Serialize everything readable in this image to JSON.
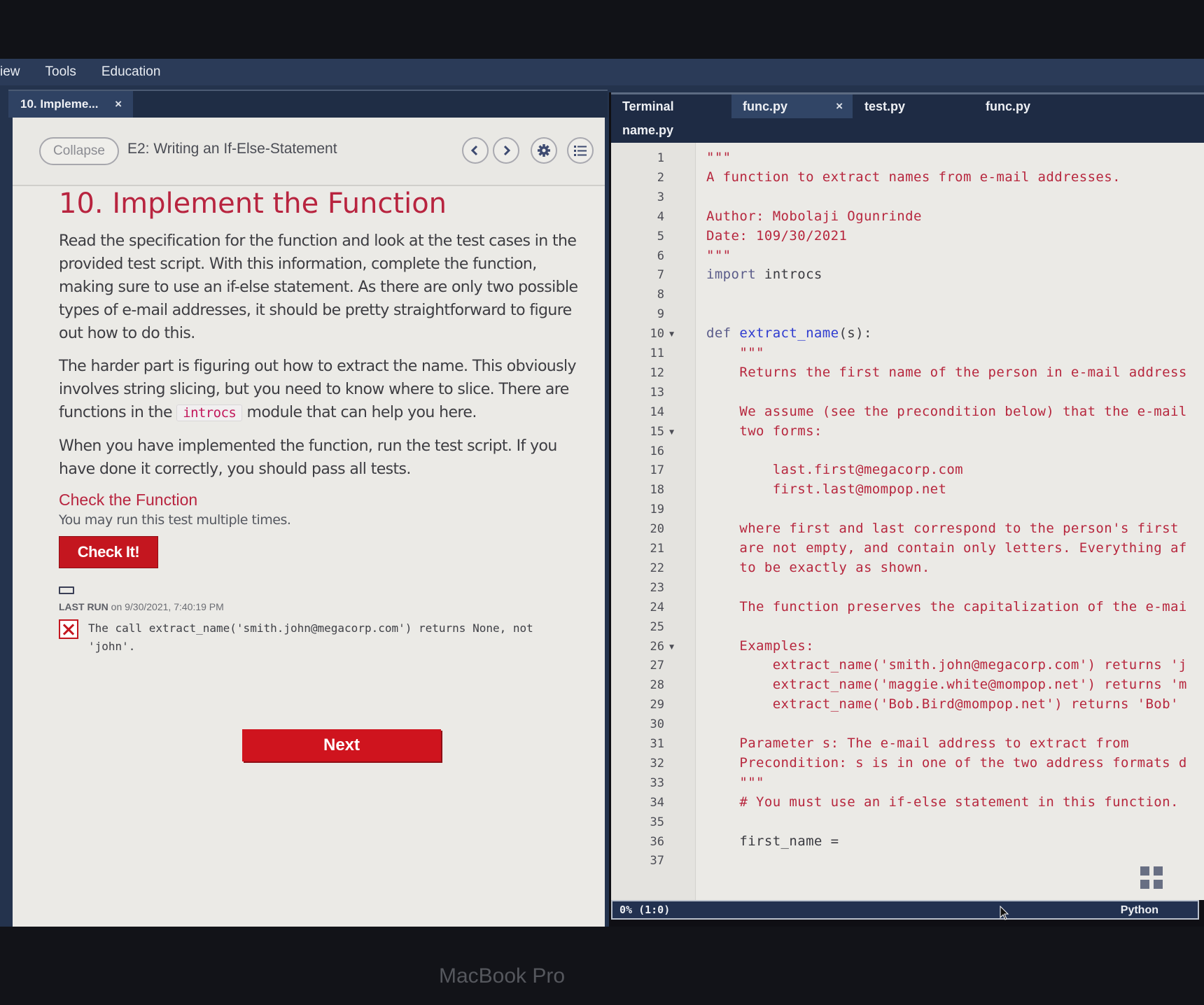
{
  "menubar": {
    "items": [
      "iew",
      "Tools",
      "Education"
    ]
  },
  "left_tab": {
    "label": "10. Impleme...",
    "close": "×"
  },
  "lesson_header": {
    "collapse_label": "Collapse",
    "lesson_name": "E2: Writing an If-Else-Statement",
    "icons": [
      "chevron-left-icon",
      "chevron-right-icon",
      "gear-icon",
      "list-icon"
    ]
  },
  "content": {
    "title": "10. Implement the Function",
    "para1": "Read the specification for the function and look at the test cases in the provided test script. With this information, complete the function, making sure to use an if-else statement. As there are only two possible types of e-mail addresses, it should be pretty straightforward to figure out how to do this.",
    "para2_before": "The harder part is figuring out how to extract the name. This obviously involves string slicing, but you need to know where to slice. There are functions in the ",
    "para2_code": "introcs",
    "para2_after": " module that can help you here.",
    "para3": "When you have implemented the function, run the test script. If you have done it correctly, you should pass all tests.",
    "check_title": "Check the Function",
    "check_note": "You may run this test multiple times.",
    "check_button": "Check It!",
    "last_run_label": "LAST RUN",
    "last_run_value": " on 9/30/2021, 7:40:19 PM",
    "result_text": "The call extract_name('smith.john@megacorp.com') returns None, not 'john'.",
    "result_status": "fail",
    "next_button": "Next"
  },
  "editor": {
    "tabs": [
      {
        "label": "Terminal",
        "active": false
      },
      {
        "label": "func.py",
        "active": true,
        "close": "×"
      },
      {
        "label": "test.py",
        "active": false
      },
      {
        "label": "func.py",
        "active": false
      },
      {
        "label": "name.py",
        "active": false
      }
    ],
    "lines": [
      {
        "n": "1",
        "text": "\"\"\""
      },
      {
        "n": "2",
        "text": "A function to extract names from e-mail addresses."
      },
      {
        "n": "3",
        "text": ""
      },
      {
        "n": "4",
        "text": "Author: Mobolaji Ogunrinde"
      },
      {
        "n": "5",
        "text": "Date: 109/30/2021"
      },
      {
        "n": "6",
        "text": "\"\"\""
      },
      {
        "n": "7",
        "text": "import introcs"
      },
      {
        "n": "8",
        "text": ""
      },
      {
        "n": "9",
        "text": ""
      },
      {
        "n": "10",
        "text": "def extract_name(s):",
        "fold": true
      },
      {
        "n": "11",
        "text": "    \"\"\""
      },
      {
        "n": "12",
        "text": "    Returns the first name of the person in e-mail address"
      },
      {
        "n": "13",
        "text": ""
      },
      {
        "n": "14",
        "text": "    We assume (see the precondition below) that the e-mail"
      },
      {
        "n": "15",
        "text": "    two forms:",
        "fold": true
      },
      {
        "n": "16",
        "text": ""
      },
      {
        "n": "17",
        "text": "        last.first@megacorp.com"
      },
      {
        "n": "18",
        "text": "        first.last@mompop.net"
      },
      {
        "n": "19",
        "text": ""
      },
      {
        "n": "20",
        "text": "    where first and last correspond to the person's first"
      },
      {
        "n": "21",
        "text": "    are not empty, and contain only letters. Everything af"
      },
      {
        "n": "22",
        "text": "    to be exactly as shown."
      },
      {
        "n": "23",
        "text": ""
      },
      {
        "n": "24",
        "text": "    The function preserves the capitalization of the e-mai"
      },
      {
        "n": "25",
        "text": ""
      },
      {
        "n": "26",
        "text": "    Examples:",
        "fold": true
      },
      {
        "n": "27",
        "text": "        extract_name('smith.john@megacorp.com') returns 'j"
      },
      {
        "n": "28",
        "text": "        extract_name('maggie.white@mompop.net') returns 'm"
      },
      {
        "n": "29",
        "text": "        extract_name('Bob.Bird@mompop.net') returns 'Bob'"
      },
      {
        "n": "30",
        "text": ""
      },
      {
        "n": "31",
        "text": "    Parameter s: The e-mail address to extract from"
      },
      {
        "n": "32",
        "text": "    Precondition: s is in one of the two address formats d"
      },
      {
        "n": "33",
        "text": "    \"\"\""
      },
      {
        "n": "34",
        "text": "    # You must use an if-else statement in this function."
      },
      {
        "n": "35",
        "text": ""
      },
      {
        "n": "36",
        "text": "    first_name ="
      },
      {
        "n": "37",
        "text": ""
      }
    ],
    "status_left": "0% (1:0)",
    "status_right": "Python"
  },
  "device_label": "MacBook Pro",
  "colors": {
    "accent_red": "#c4161f",
    "title_red": "#b8243f",
    "string_red": "#b7273e",
    "function_blue": "#2e3bd0",
    "menubar_bg": "#2b3b58"
  }
}
